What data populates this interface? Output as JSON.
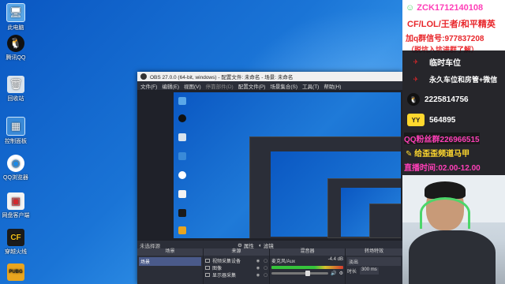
{
  "desktop": {
    "icons": [
      {
        "label": "此电脑",
        "icon": "computer-icon"
      },
      {
        "label": "腾讯QQ",
        "icon": "qq-icon"
      },
      {
        "label": "回收站",
        "icon": "recycle-bin-icon"
      },
      {
        "label": "控制面板",
        "icon": "control-panel-icon"
      },
      {
        "label": "QQ浏览器",
        "icon": "qq-browser-icon"
      },
      {
        "label": "网盘客户端",
        "icon": "netdisk-icon"
      },
      {
        "label": "穿越火线",
        "icon": "crossfire-icon"
      },
      {
        "label": "PUBG",
        "icon": "pubg-icon"
      }
    ]
  },
  "obs": {
    "title": "OBS 27.0.0 (64-bit, windows) - 配置文件: 未命名 - 场景: 未命名",
    "menu": [
      "文件(F)",
      "编辑(E)",
      "视图(V)",
      "停靠部件(D)",
      "配置文件(P)",
      "场景集合(S)",
      "工具(T)",
      "帮助(H)"
    ],
    "status": {
      "no_source": "未选择源",
      "properties": "属性",
      "filters": "滤镜"
    },
    "docks": {
      "scenes": {
        "header": "场景",
        "items": [
          "场景"
        ]
      },
      "sources": {
        "header": "来源",
        "items": [
          {
            "label": "视频采集设备"
          },
          {
            "label": "图像"
          },
          {
            "label": "显示器采集"
          }
        ]
      },
      "mixer": {
        "header": "混音器",
        "track_label": "麦克风/Aux",
        "level": "-4.4 dB"
      },
      "transitions": {
        "header": "转场特效",
        "fade": "淡出",
        "duration_label": "时长",
        "duration": "300 ms"
      }
    }
  },
  "overlay": {
    "id_line": "ZCK1712140108",
    "games_line": "CF/LOL/王者/和平精英",
    "qgroup_line": "加q群信号:977837208",
    "note_line": "（脱坑入坑进群了解）",
    "promos": [
      {
        "icon": "plane-icon",
        "text": "临时车位"
      },
      {
        "icon": "plane-icon",
        "text": "永久车位和房管+微信"
      },
      {
        "icon": "qq-icon",
        "text": "2225814756"
      },
      {
        "icon": "yy-icon",
        "text": "564895"
      }
    ],
    "fan_group": "QQ粉丝群226966515",
    "channel_note": "给歪歪频道马甲",
    "schedule": "直播时间:02.00-12.00"
  },
  "colors": {
    "overlay_red": "#e8262a",
    "overlay_yellow": "#ffd82e",
    "overlay_magenta": "#ff3fb8",
    "obs_bg": "#2b2e38",
    "desktop_blue": "#1a74d6"
  }
}
